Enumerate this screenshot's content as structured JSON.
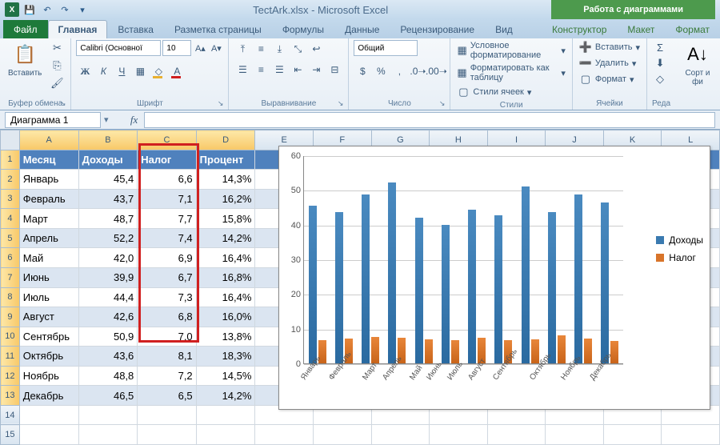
{
  "title": {
    "filename": "TectArk.xlsx",
    "app": "Microsoft Excel",
    "chart_context": "Работа с диаграммами"
  },
  "tabs": {
    "file": "Файл",
    "home": "Главная",
    "insert": "Вставка",
    "layout": "Разметка страницы",
    "formulas": "Формулы",
    "data": "Данные",
    "review": "Рецензирование",
    "view": "Вид",
    "ctx_designer": "Конструктор",
    "ctx_layout": "Макет",
    "ctx_format": "Формат"
  },
  "ribbon": {
    "clipboard": {
      "label": "Буфер обмена",
      "paste": "Вставить"
    },
    "font": {
      "label": "Шрифт",
      "name": "Calibri (Основної",
      "size": "10",
      "bold": "Ж",
      "italic": "К",
      "underline": "Ч"
    },
    "alignment": {
      "label": "Выравнивание"
    },
    "number": {
      "label": "Число",
      "format": "Общий"
    },
    "styles": {
      "label": "Стили",
      "cond": "Условное форматирование",
      "table": "Форматировать как таблицу",
      "cell": "Стили ячеек"
    },
    "cells": {
      "label": "Ячейки",
      "insert": "Вставить",
      "delete": "Удалить",
      "format": "Формат"
    },
    "editing": {
      "label": "Реда",
      "sort": "Сорт\nи фи"
    }
  },
  "formula_bar": {
    "namebox": "Диаграмма 1"
  },
  "columns": [
    "A",
    "B",
    "C",
    "D",
    "E",
    "F",
    "G",
    "H",
    "I",
    "J",
    "K",
    "L"
  ],
  "headers": {
    "month": "Месяц",
    "income": "Доходы",
    "tax": "Налог",
    "percent": "Процент"
  },
  "rows": [
    {
      "month": "Январь",
      "income": "45,4",
      "tax": "6,6",
      "percent": "14,3%"
    },
    {
      "month": "Февраль",
      "income": "43,7",
      "tax": "7,1",
      "percent": "16,2%"
    },
    {
      "month": "Март",
      "income": "48,7",
      "tax": "7,7",
      "percent": "15,8%"
    },
    {
      "month": "Апрель",
      "income": "52,2",
      "tax": "7,4",
      "percent": "14,2%"
    },
    {
      "month": "Май",
      "income": "42,0",
      "tax": "6,9",
      "percent": "16,4%"
    },
    {
      "month": "Июнь",
      "income": "39,9",
      "tax": "6,7",
      "percent": "16,8%"
    },
    {
      "month": "Июль",
      "income": "44,4",
      "tax": "7,3",
      "percent": "16,4%"
    },
    {
      "month": "Август",
      "income": "42,6",
      "tax": "6,8",
      "percent": "16,0%"
    },
    {
      "month": "Сентябрь",
      "income": "50,9",
      "tax": "7,0",
      "percent": "13,8%"
    },
    {
      "month": "Октябрь",
      "income": "43,6",
      "tax": "8,1",
      "percent": "18,3%"
    },
    {
      "month": "Ноябрь",
      "income": "48,8",
      "tax": "7,2",
      "percent": "14,5%"
    },
    {
      "month": "Декабрь",
      "income": "46,5",
      "tax": "6,5",
      "percent": "14,2%"
    }
  ],
  "chart_data": {
    "type": "bar",
    "categories": [
      "Январь",
      "Февраль",
      "Март",
      "Апрель",
      "Май",
      "Июнь",
      "Июль",
      "Август",
      "Сентябрь",
      "Октябрь",
      "Ноябрь",
      "Декабрь"
    ],
    "series": [
      {
        "name": "Доходы",
        "values": [
          45.4,
          43.7,
          48.7,
          52.2,
          42.0,
          39.9,
          44.4,
          42.6,
          50.9,
          43.6,
          48.8,
          46.5
        ]
      },
      {
        "name": "Налог",
        "values": [
          6.6,
          7.1,
          7.7,
          7.4,
          6.9,
          6.7,
          7.3,
          6.8,
          7.0,
          8.1,
          7.2,
          6.5
        ]
      }
    ],
    "ylim": [
      0,
      60
    ],
    "yticks": [
      0,
      10,
      20,
      30,
      40,
      50,
      60
    ],
    "title": "",
    "xlabel": "",
    "ylabel": ""
  }
}
